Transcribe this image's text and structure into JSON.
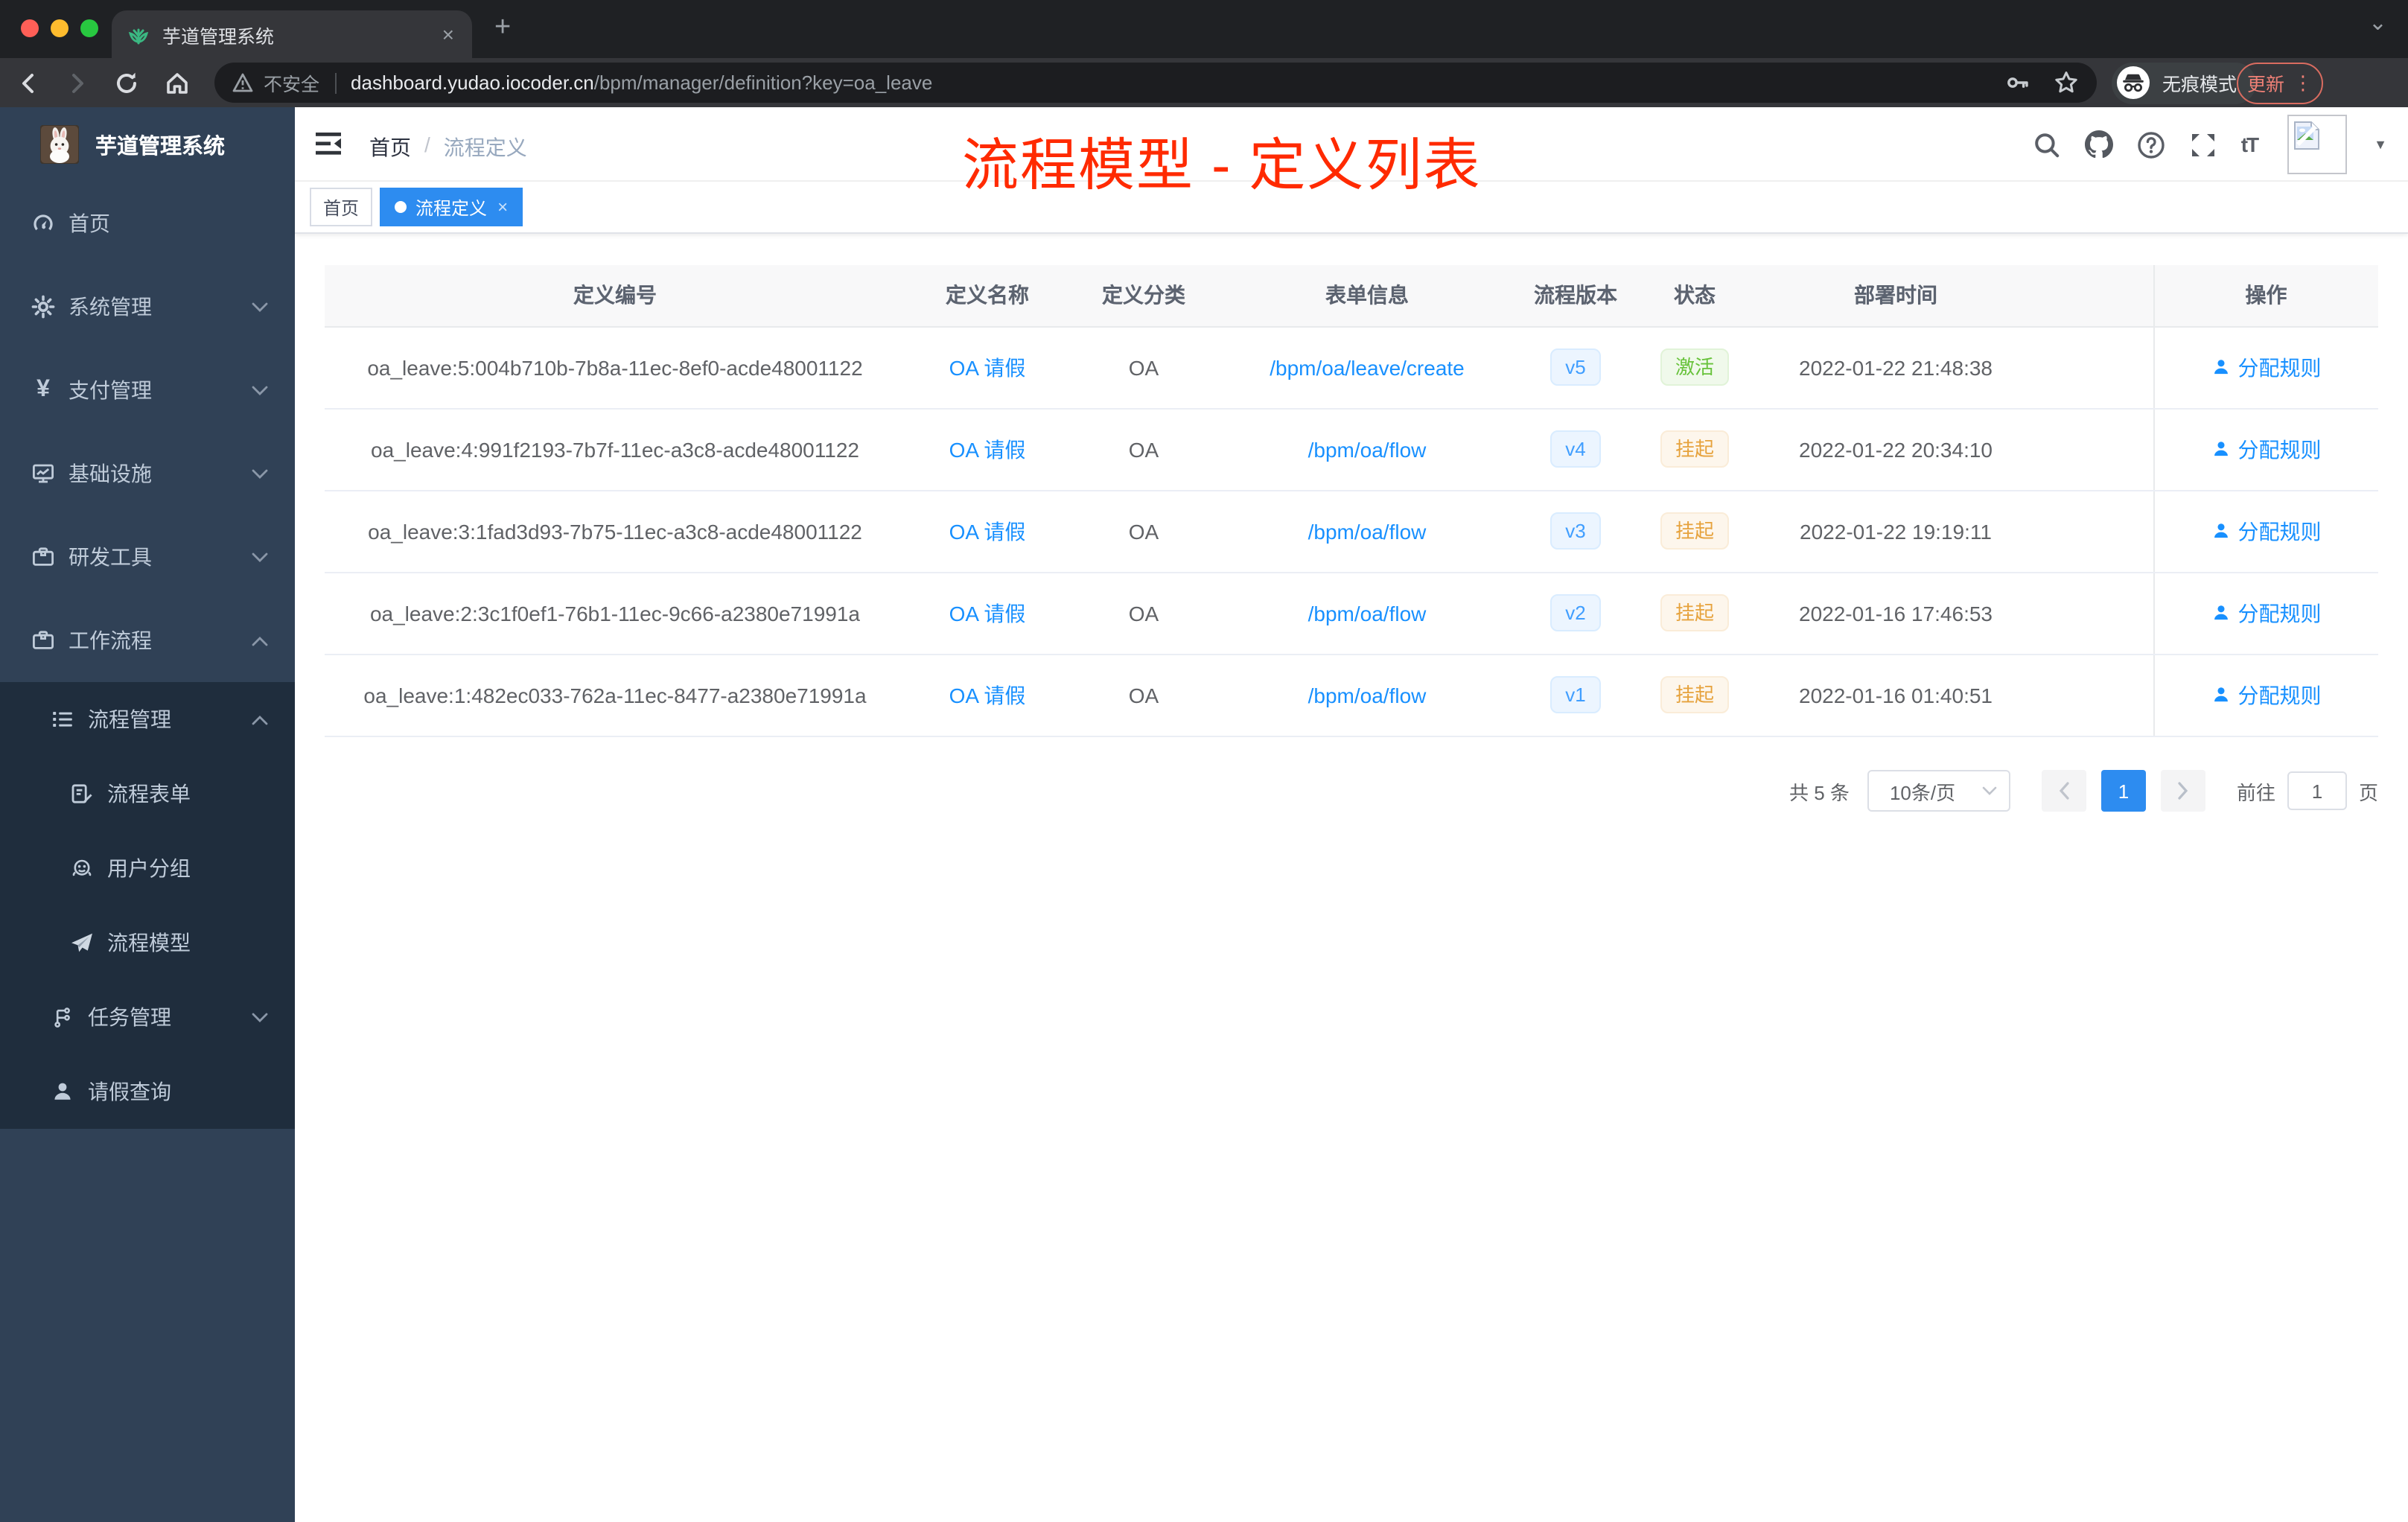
{
  "browser": {
    "tab_title": "芋道管理系统",
    "security_label": "不安全",
    "url_host": "dashboard.yudao.iocoder.cn",
    "url_path": "/bpm/manager/definition?key=oa_leave",
    "incognito_label": "无痕模式",
    "update_label": "更新"
  },
  "icons": {
    "plus": "+",
    "tab_close": "×",
    "tab_search_caret": "⌄",
    "kebab": "⋮",
    "yen": "¥",
    "help_mark": "?",
    "text_size": "tT",
    "avatar_caret": "▼",
    "tag_close": "×"
  },
  "sidebar": {
    "logo_title": "芋道管理系统",
    "items": [
      {
        "label": "首页"
      },
      {
        "label": "系统管理"
      },
      {
        "label": "支付管理"
      },
      {
        "label": "基础设施"
      },
      {
        "label": "研发工具"
      },
      {
        "label": "工作流程"
      },
      {
        "label": "流程管理"
      },
      {
        "label": "流程表单"
      },
      {
        "label": "用户分组"
      },
      {
        "label": "流程模型"
      },
      {
        "label": "任务管理"
      },
      {
        "label": "请假查询"
      }
    ]
  },
  "header": {
    "breadcrumb_home": "首页",
    "breadcrumb_sep": "/",
    "breadcrumb_current": "流程定义",
    "annotation": "流程模型 - 定义列表"
  },
  "tags": {
    "home": "首页",
    "active": "流程定义"
  },
  "table": {
    "columns": [
      "定义编号",
      "定义名称",
      "定义分类",
      "表单信息",
      "流程版本",
      "状态",
      "部署时间",
      "操作"
    ],
    "rows": [
      {
        "id": "oa_leave:5:004b710b-7b8a-11ec-8ef0-acde48001122",
        "name": "OA 请假",
        "category": "OA",
        "form": "/bpm/oa/leave/create",
        "version": "v5",
        "status": "激活",
        "time": "2022-01-22 21:48:38",
        "action": "分配规则"
      },
      {
        "id": "oa_leave:4:991f2193-7b7f-11ec-a3c8-acde48001122",
        "name": "OA 请假",
        "category": "OA",
        "form": "/bpm/oa/flow",
        "version": "v4",
        "status": "挂起",
        "time": "2022-01-22 20:34:10",
        "action": "分配规则"
      },
      {
        "id": "oa_leave:3:1fad3d93-7b75-11ec-a3c8-acde48001122",
        "name": "OA 请假",
        "category": "OA",
        "form": "/bpm/oa/flow",
        "version": "v3",
        "status": "挂起",
        "time": "2022-01-22 19:19:11",
        "action": "分配规则"
      },
      {
        "id": "oa_leave:2:3c1f0ef1-76b1-11ec-9c66-a2380e71991a",
        "name": "OA 请假",
        "category": "OA",
        "form": "/bpm/oa/flow",
        "version": "v2",
        "status": "挂起",
        "time": "2022-01-16 17:46:53",
        "action": "分配规则"
      },
      {
        "id": "oa_leave:1:482ec033-762a-11ec-8477-a2380e71991a",
        "name": "OA 请假",
        "category": "OA",
        "form": "/bpm/oa/flow",
        "version": "v1",
        "status": "挂起",
        "time": "2022-01-16 01:40:51",
        "action": "分配规则"
      }
    ]
  },
  "pagination": {
    "total": "共 5 条",
    "page_size": "10条/页",
    "page": "1",
    "goto_label": "前往",
    "goto_value": "1",
    "unit_label": "页"
  }
}
